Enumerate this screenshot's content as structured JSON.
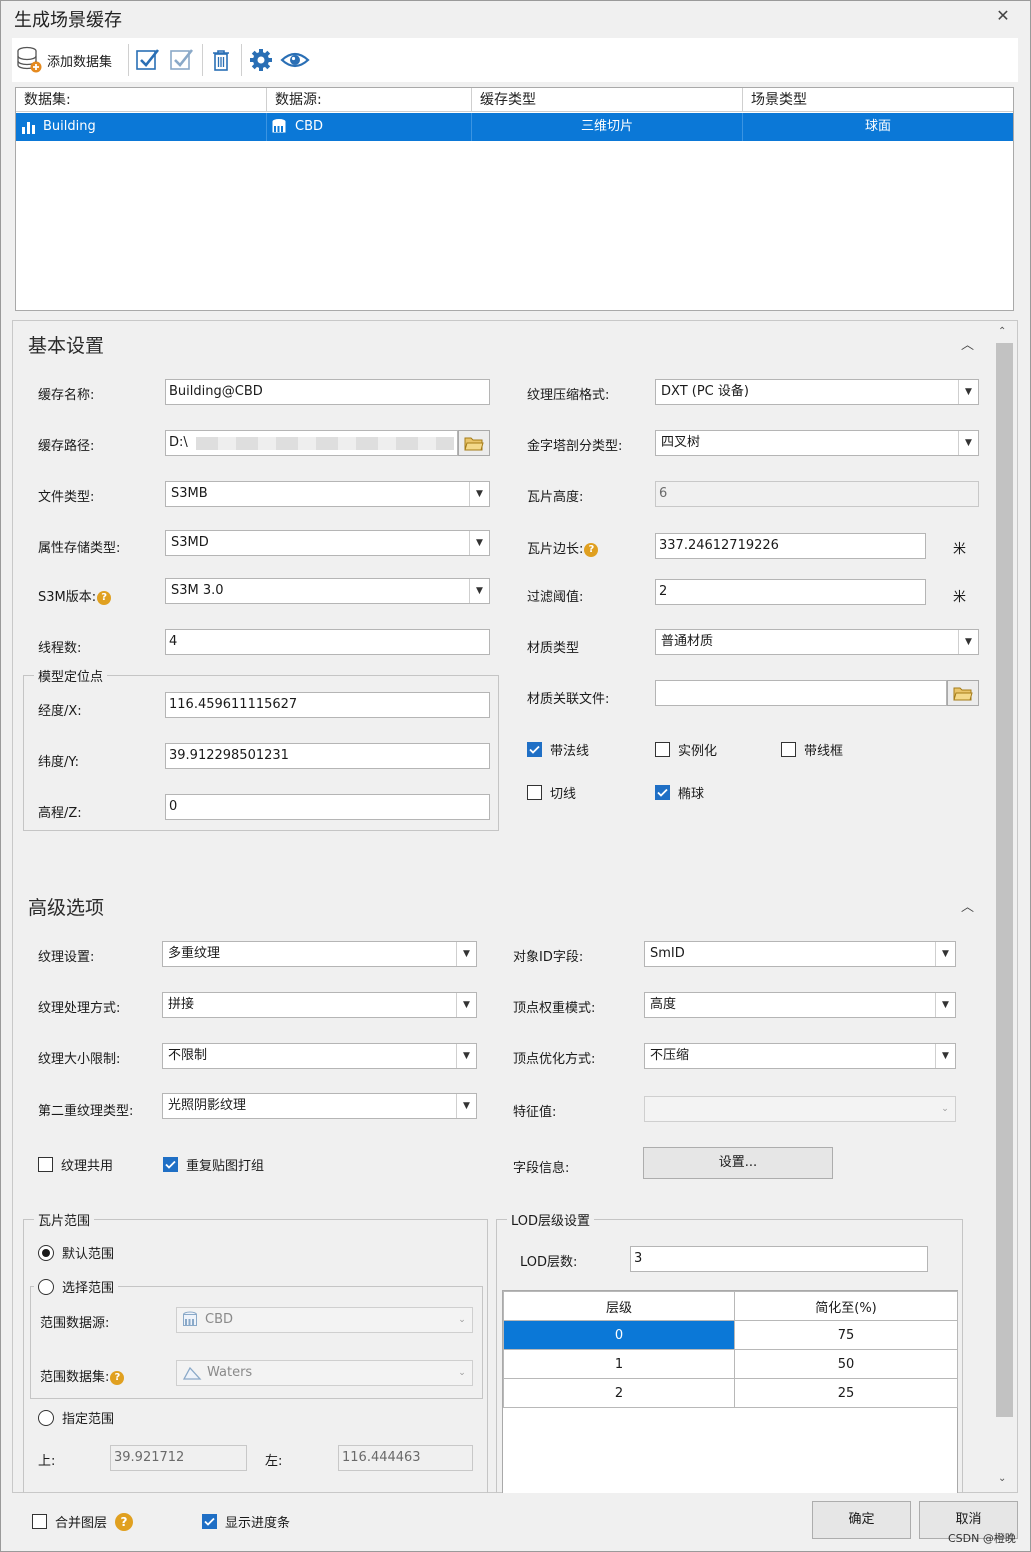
{
  "window": {
    "title": "生成场景缓存",
    "close_glyph": "✕"
  },
  "toolbar": {
    "add_dataset_label": "添加数据集"
  },
  "grid": {
    "columns": [
      "数据集:",
      "数据源:",
      "缓存类型",
      "场景类型"
    ],
    "rows": [
      {
        "dataset": "Building",
        "datasource": "CBD",
        "cache_type": "三维切片",
        "scene_type": "球面"
      }
    ]
  },
  "basic": {
    "title": "基本设置",
    "cache_name_label": "缓存名称:",
    "cache_name_value": "Building@CBD",
    "cache_path_label": "缓存路径:",
    "cache_path_value": "D:\\",
    "file_type_label": "文件类型:",
    "file_type_value": "S3MB",
    "attr_storage_label": "属性存储类型:",
    "attr_storage_value": "S3MD",
    "s3m_version_label": "S3M版本:",
    "s3m_version_value": "S3M 3.0",
    "threads_label": "线程数:",
    "threads_value": "4",
    "anchor_group": "模型定位点",
    "lon_label": "经度/X:",
    "lon_value": "116.459611115627",
    "lat_label": "纬度/Y:",
    "lat_value": "39.912298501231",
    "elev_label": "高程/Z:",
    "elev_value": "0",
    "tex_compress_label": "纹理压缩格式:",
    "tex_compress_value": "DXT (PC 设备)",
    "pyramid_label": "金字塔剖分类型:",
    "pyramid_value": "四叉树",
    "tile_height_label": "瓦片高度:",
    "tile_height_value": "6",
    "tile_edge_label": "瓦片边长:",
    "tile_edge_value": "337.24612719226",
    "unit_meter": "米",
    "filter_label": "过滤阈值:",
    "filter_value": "2",
    "material_type_label": "材质类型",
    "material_type_value": "普通材质",
    "material_file_label": "材质关联文件:",
    "material_file_value": "",
    "cb_normals": "带法线",
    "cb_instancing": "实例化",
    "cb_wireframe": "带线框",
    "cb_tangent": "切线",
    "cb_ellipsoid": "椭球"
  },
  "advanced": {
    "title": "高级选项",
    "tex_setting_label": "纹理设置:",
    "tex_setting_value": "多重纹理",
    "tex_process_label": "纹理处理方式:",
    "tex_process_value": "拼接",
    "tex_size_label": "纹理大小限制:",
    "tex_size_value": "不限制",
    "second_tex_label": "第二重纹理类型:",
    "second_tex_value": "光照阴影纹理",
    "obj_id_label": "对象ID字段:",
    "obj_id_value": "SmID",
    "vertex_weight_label": "顶点权重模式:",
    "vertex_weight_value": "高度",
    "vertex_opt_label": "顶点优化方式:",
    "vertex_opt_value": "不压缩",
    "feature_label": "特征值:",
    "feature_value": "",
    "cb_tex_share": "纹理共用",
    "cb_repeat_tex": "重复贴图打组",
    "field_info_label": "字段信息:",
    "settings_button": "设置..."
  },
  "tile_range": {
    "group": "瓦片范围",
    "default_range": "默认范围",
    "select_range": "选择范围",
    "range_ds_label": "范围数据源:",
    "range_ds_value": "CBD",
    "range_dataset_label": "范围数据集:",
    "range_dataset_value": "Waters",
    "specify_range": "指定范围",
    "top_label": "上:",
    "top_value": "39.921712",
    "left_label": "左:",
    "left_value": "116.444463"
  },
  "lod": {
    "group": "LOD层级设置",
    "count_label": "LOD层数:",
    "count_value": "3",
    "col_level": "层级",
    "col_simplify": "简化至(%)",
    "rows": [
      {
        "level": "0",
        "simplify": "75"
      },
      {
        "level": "1",
        "simplify": "50"
      },
      {
        "level": "2",
        "simplify": "25"
      }
    ]
  },
  "footer": {
    "merge_layers": "合并图层",
    "show_progress": "显示进度条",
    "ok": "确定",
    "cancel": "取消",
    "watermark": "CSDN @橙晚"
  },
  "colors": {
    "selection": "#0b78d7",
    "checkbox_on": "#1f6fc5",
    "help_icon": "#e0a020"
  }
}
